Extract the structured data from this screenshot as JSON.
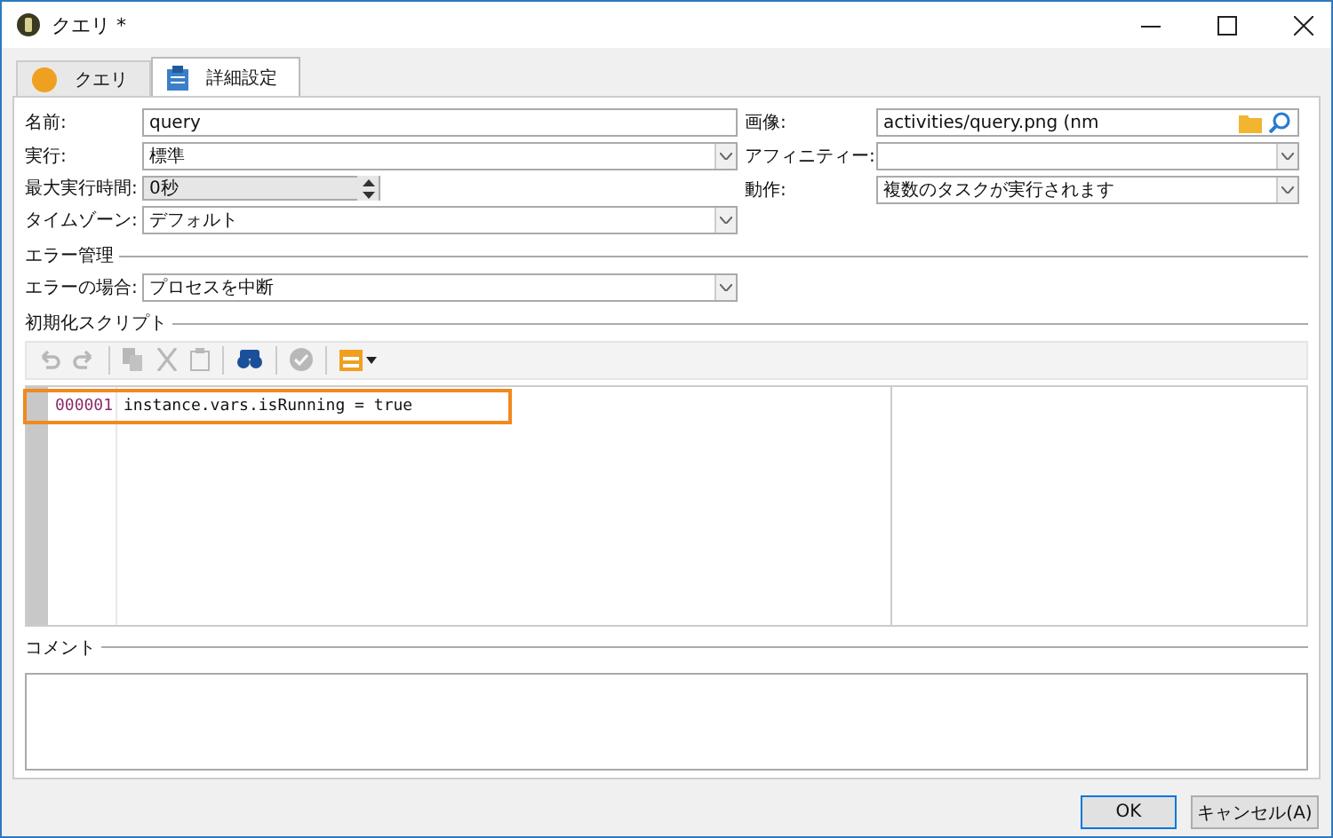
{
  "window": {
    "title": "クエリ *"
  },
  "tabs": [
    {
      "label": "クエリ",
      "kind": "circle",
      "selected": false
    },
    {
      "label": "詳細設定",
      "kind": "clipboard",
      "selected": true
    }
  ],
  "left_fields": [
    {
      "label": "名前:",
      "value": "query",
      "kind": "text"
    },
    {
      "label": "実行:",
      "value": "標準",
      "kind": "select"
    },
    {
      "label": "最大実行時間:",
      "value": "0秒",
      "kind": "spin"
    },
    {
      "label": "タイムゾーン:",
      "value": "デフォルト",
      "kind": "select"
    }
  ],
  "right_fields": [
    {
      "label": "画像:",
      "value": "activities/query.png (nm",
      "kind": "file"
    },
    {
      "label": "アフィニティー:",
      "kind": "select"
    },
    {
      "label": "動作:",
      "value": "複数のタスクが実行されます",
      "kind": "select"
    }
  ],
  "error_section": {
    "title": "エラー管理",
    "fields": [
      {
        "label": "エラーの場合:",
        "value": "プロセスを中断",
        "kind": "select"
      }
    ]
  },
  "script_section": {
    "title": "初期化スクリプト",
    "toolbar": [
      {
        "kind": "undo",
        "disabled": true
      },
      {
        "kind": "redo",
        "disabled": true
      },
      {
        "kind": "sep"
      },
      {
        "kind": "copy",
        "disabled": true
      },
      {
        "kind": "cut",
        "disabled": true
      },
      {
        "kind": "paste",
        "disabled": true
      },
      {
        "kind": "sep"
      },
      {
        "kind": "find",
        "disabled": false
      },
      {
        "kind": "sep"
      },
      {
        "kind": "check",
        "disabled": true
      },
      {
        "kind": "sep"
      },
      {
        "kind": "menu",
        "disabled": false
      }
    ],
    "lines": [
      {
        "number": "000001",
        "code": "instance.vars.isRunning = true",
        "highlighted": true
      }
    ]
  },
  "comment_section": {
    "title": "コメント"
  },
  "buttons": [
    {
      "label": "OK",
      "default": true
    },
    {
      "label": "キャンセル(A)",
      "default": false
    }
  ]
}
